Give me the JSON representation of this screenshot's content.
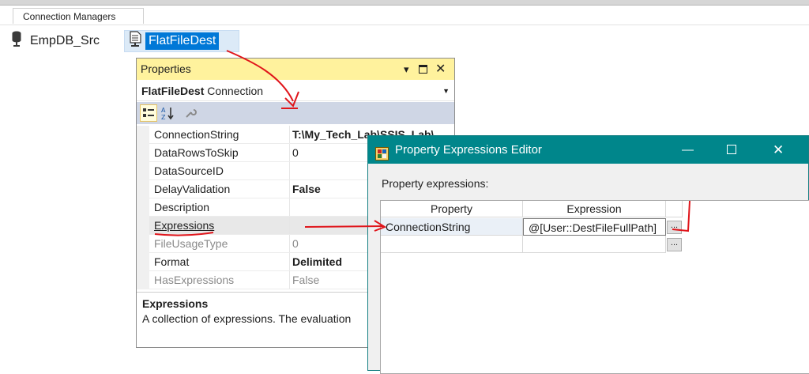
{
  "tab": {
    "label": "Connection Managers"
  },
  "connections": [
    {
      "label": "EmpDB_Src"
    },
    {
      "label": "FlatFileDest"
    }
  ],
  "properties_panel": {
    "title": "Properties",
    "object_name": "FlatFileDest",
    "object_type": "Connection",
    "rows": [
      {
        "name": "ConnectionString",
        "value": "T:\\My_Tech_Lab\\SSIS_Lab\\"
      },
      {
        "name": "DataRowsToSkip",
        "value": "0"
      },
      {
        "name": "DataSourceID",
        "value": ""
      },
      {
        "name": "DelayValidation",
        "value": "False"
      },
      {
        "name": "Description",
        "value": ""
      },
      {
        "name": "Expressions",
        "value": ""
      },
      {
        "name": "FileUsageType",
        "value": "0"
      },
      {
        "name": "Format",
        "value": "Delimited"
      },
      {
        "name": "HasExpressions",
        "value": "False"
      }
    ],
    "description_title": "Expressions",
    "description_text": "A collection of expressions. The evaluation"
  },
  "editor": {
    "title": "Property Expressions Editor",
    "label": "Property expressions:",
    "columns": [
      "Property",
      "Expression"
    ],
    "rows": [
      {
        "property": "ConnectionString",
        "expression": "@[User::DestFileFullPath]"
      }
    ],
    "ellipsis": "..."
  },
  "colors": {
    "title_accent": "#00868b",
    "properties_title_bg": "#fff29d",
    "selection_blue": "#0078d7",
    "annotation_red": "#e0151b"
  }
}
